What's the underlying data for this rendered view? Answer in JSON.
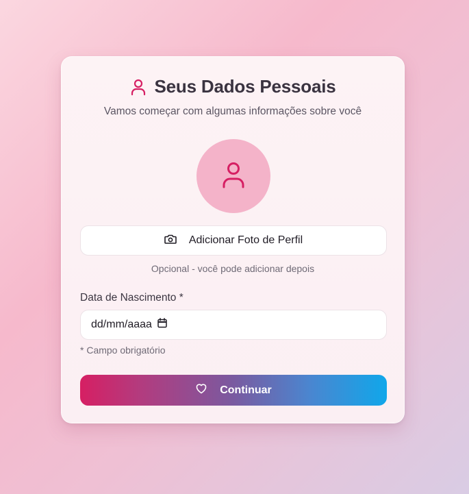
{
  "header": {
    "title": "Seus Dados Pessoais",
    "subtitle": "Vamos começar com algumas informações sobre você",
    "icon": "user-icon"
  },
  "avatar": {
    "icon": "user-icon"
  },
  "photo_button": {
    "label": "Adicionar Foto de Perfil",
    "icon": "camera-icon"
  },
  "photo_hint": "Opcional - você pode adicionar depois",
  "birth_date": {
    "label": "Data de Nascimento *",
    "placeholder": "dd/mm/aaaa",
    "icon": "calendar-icon",
    "note": "* Campo obrigatório"
  },
  "continue_button": {
    "label": "Continuar",
    "icon": "heart-icon"
  },
  "colors": {
    "accent": "#d61f63",
    "avatar_bg": "#f4b3c9",
    "button_gradient_start": "#d61f63",
    "button_gradient_end": "#10a7ea"
  }
}
